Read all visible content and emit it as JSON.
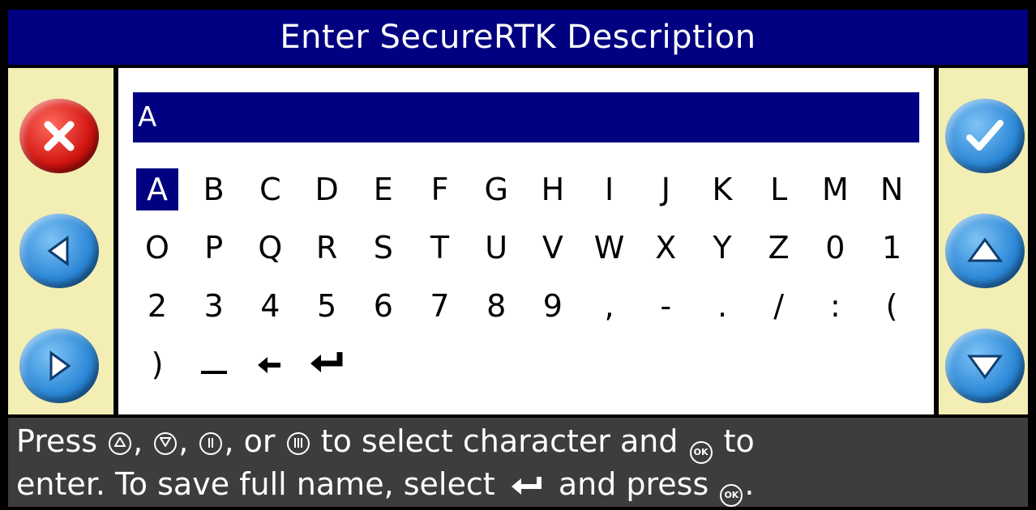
{
  "title": "Enter SecureRTK Description",
  "input": {
    "value": "A"
  },
  "keys": [
    {
      "label": "A",
      "selected": true
    },
    {
      "label": "B"
    },
    {
      "label": "C"
    },
    {
      "label": "D"
    },
    {
      "label": "E"
    },
    {
      "label": "F"
    },
    {
      "label": "G"
    },
    {
      "label": "H"
    },
    {
      "label": "I"
    },
    {
      "label": "J"
    },
    {
      "label": "K"
    },
    {
      "label": "L"
    },
    {
      "label": "M"
    },
    {
      "label": "N"
    },
    {
      "label": "O"
    },
    {
      "label": "P"
    },
    {
      "label": "Q"
    },
    {
      "label": "R"
    },
    {
      "label": "S"
    },
    {
      "label": "T"
    },
    {
      "label": "U"
    },
    {
      "label": "V"
    },
    {
      "label": "W"
    },
    {
      "label": "X"
    },
    {
      "label": "Y"
    },
    {
      "label": "Z"
    },
    {
      "label": "0"
    },
    {
      "label": "1"
    },
    {
      "label": "2"
    },
    {
      "label": "3"
    },
    {
      "label": "4"
    },
    {
      "label": "5"
    },
    {
      "label": "6"
    },
    {
      "label": "7"
    },
    {
      "label": "8"
    },
    {
      "label": "9"
    },
    {
      "label": ","
    },
    {
      "label": "-"
    },
    {
      "label": "."
    },
    {
      "label": "/"
    },
    {
      "label": ":"
    },
    {
      "label": "("
    },
    {
      "label": ")"
    },
    {
      "icon": "space-icon"
    },
    {
      "icon": "backspace-icon"
    },
    {
      "icon": "enter-icon"
    }
  ],
  "buttons": {
    "cancel": "cancel-x-icon",
    "left": "triangle-left-icon",
    "right": "triangle-right-icon",
    "ok": "checkmark-icon",
    "up": "triangle-up-icon",
    "down": "triangle-down-icon"
  },
  "instructions": {
    "line1_press": "Press",
    "sep1": ",",
    "sep2": ",",
    "sep3": ", or",
    "line1_mid": "to select character and",
    "line1_to": "to",
    "line2_a": "enter. To save full name, select",
    "line2_b": "and press",
    "line2_end": "."
  },
  "colors": {
    "title_bg": "#000080",
    "side_bg": "#f2eeb4",
    "instructions_bg": "#3d3d3d",
    "selected_bg": "#000080"
  }
}
